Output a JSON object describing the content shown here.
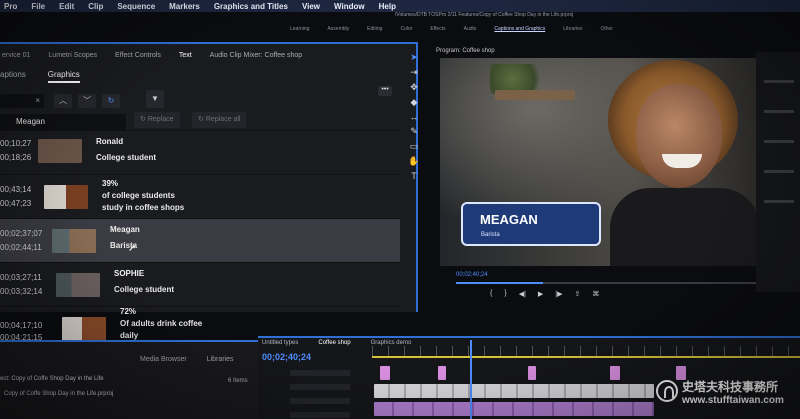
{
  "menubar": {
    "app": "Pro",
    "items": [
      "File",
      "Edit",
      "Clip",
      "Sequence",
      "Markers",
      "Graphics and Titles",
      "View",
      "Window",
      "Help"
    ]
  },
  "title_path": "/Volumes/DTB TOSPro 2/11 Features/Copy of Coffee Shop Day in the Life.prproj",
  "workspaces": {
    "items": [
      "Learning",
      "Assembly",
      "Editing",
      "Color",
      "Effects",
      "Audio",
      "Captions and Graphics",
      "Libraries",
      "Other"
    ],
    "active_index": 6
  },
  "left_panel": {
    "tabs": [
      "ervice 01",
      "Lumetri Scopes",
      "Effect Controls",
      "Text",
      "Audio Clip Mixer: Coffee shop"
    ],
    "active_tab_index": 3,
    "subtabs": [
      "aptions",
      "Graphics"
    ],
    "active_subtab_index": 1,
    "find_clear": "×",
    "replace_value": "Meagan",
    "replace_label": "Replace",
    "replace_all_label": "Replace all",
    "menu_icon": "more-icon"
  },
  "rows": [
    {
      "tc_in": "00;10;27",
      "tc_out": "00;18;26",
      "lines": [
        "Ronald",
        "College student"
      ],
      "thumb_color": "#6a5448"
    },
    {
      "tc_in": "00;43;14",
      "tc_out": "00;47;23",
      "lines": [
        "39%",
        "of college students",
        "study in coffee shops"
      ],
      "thumb_color": "#7a3f22"
    },
    {
      "tc_in": "00;02;37;07",
      "tc_out": "00;02;44;11",
      "lines": [
        "Meagan",
        "Barista"
      ],
      "thumb_color": "#8a6d54",
      "selected": true
    },
    {
      "tc_in": "00;03;27;11",
      "tc_out": "00;03;32;14",
      "lines": [
        "SOPHIE",
        "College student"
      ],
      "thumb_color": "#6c6160"
    },
    {
      "tc_in": "00;04;17;10",
      "tc_out": "00;04;21;15",
      "lines": [
        "72%",
        "Of adults drink coffee",
        "daily"
      ],
      "thumb_color": "#8a4b2a"
    }
  ],
  "bottom_panel": {
    "tabs": [
      "Media Browser",
      "Libraries"
    ],
    "project_label": "ect: Copy of Coffe Shop Day in the Life",
    "project_file": "Copy of Coffe Shop Day in the Life.prproj",
    "items_count": "6 Items"
  },
  "program": {
    "label": "Program: Coffee shop",
    "lower_third_name": "MEAGAN",
    "lower_third_role": "Barista",
    "timecode": "00;02;40;24",
    "progress": 0.29
  },
  "timeline": {
    "tabs": [
      "Untitled types",
      "Coffee shop",
      "Graphics demo"
    ],
    "active_tab_index": 1,
    "timecode": "00;02;40;24"
  },
  "watermark": {
    "line1": "史塔夫科技事務所",
    "line2": "www.stufftaiwan.com"
  },
  "colors": {
    "accent": "#2f6fd6",
    "timecode_blue": "#4f8dff",
    "lower_third_bg": "#1e3a78",
    "clip_pink": "#d98fe0",
    "clip_white": "#d9d9de"
  }
}
